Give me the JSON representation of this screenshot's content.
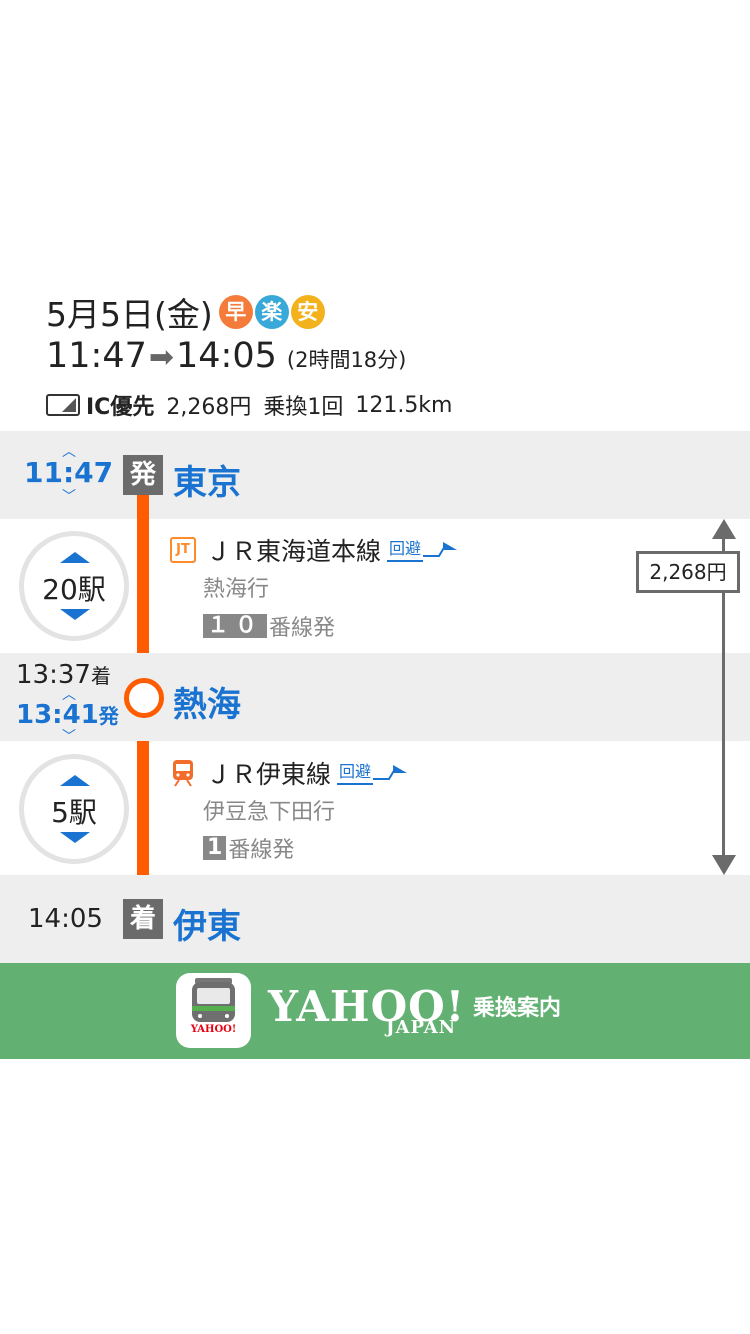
{
  "header": {
    "date": "5月5日(金)",
    "badges": [
      {
        "label": "早",
        "color": "#f47b3a"
      },
      {
        "label": "楽",
        "color": "#38a8d8"
      },
      {
        "label": "安",
        "color": "#f3b21c"
      }
    ],
    "depart_time": "11:47",
    "arrow": "➡",
    "arrive_time": "14:05",
    "duration": "(2時間18分)",
    "ic_label": "IC優先",
    "fare": "2,268円",
    "transfers": "乗換1回",
    "distance": "121.5km"
  },
  "route": {
    "origin": {
      "time": "11:47",
      "label": "発",
      "station": "東京"
    },
    "segment1": {
      "stops": "20駅",
      "line": "ＪＲ東海道本線",
      "avoid": "回避",
      "destination": "熱海行",
      "platform_num": "１０",
      "platform_suffix": "番線発"
    },
    "transfer": {
      "arrive_time": "13:37",
      "arrive_label": "着",
      "depart_time": "13:41",
      "depart_label": "発",
      "station": "熱海"
    },
    "segment2": {
      "stops": "5駅",
      "line": "ＪＲ伊東線",
      "avoid": "回避",
      "destination": "伊豆急下田行",
      "platform_num": "1",
      "platform_suffix": "番線発"
    },
    "destination": {
      "time": "14:05",
      "label": "着",
      "station": "伊東"
    },
    "fare": "2,268円"
  },
  "footer": {
    "logo": "YAHOO!",
    "logo_sub": "JAPAN",
    "service": "乗換案内",
    "icon_text": "YAHOO!"
  },
  "colors": {
    "accent": "#1a73d1",
    "route": "#ff5b00",
    "footer": "#62b173"
  }
}
